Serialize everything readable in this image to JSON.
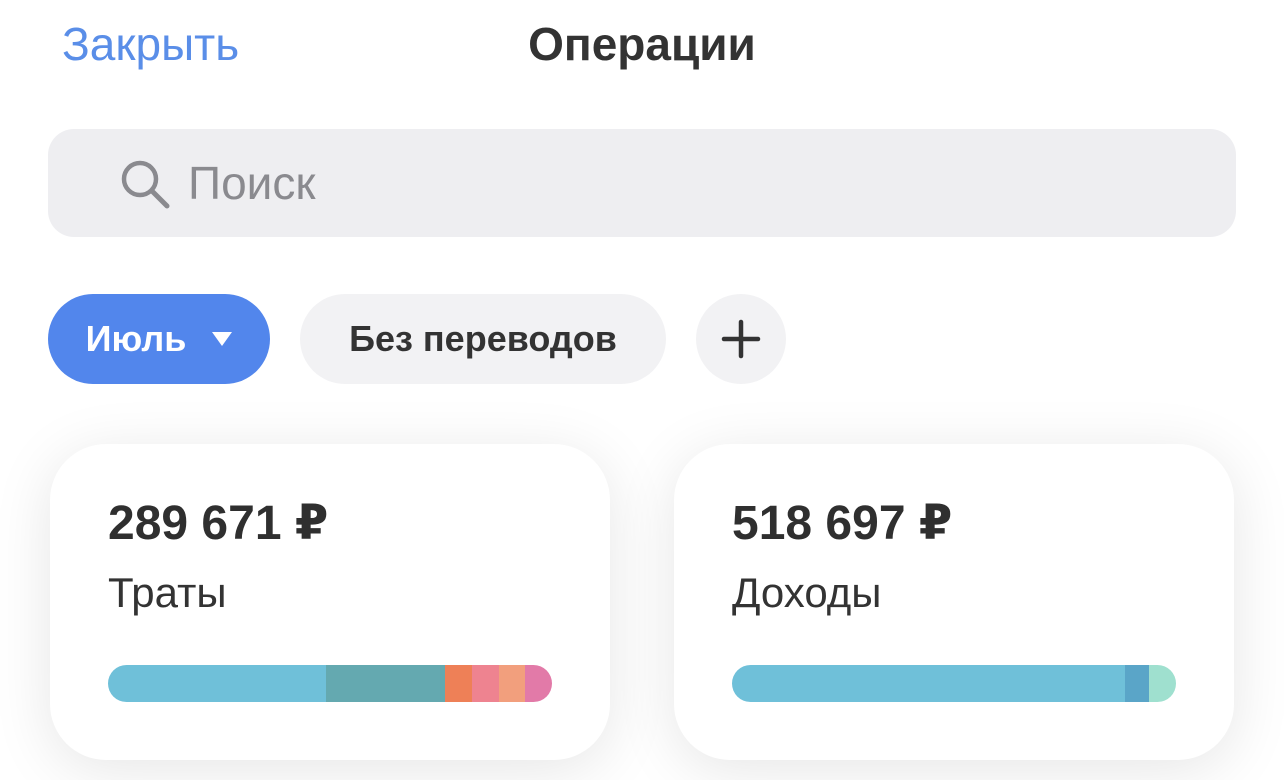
{
  "header": {
    "close_label": "Закрыть",
    "title": "Операции"
  },
  "search": {
    "placeholder": "Поиск",
    "value": ""
  },
  "filters": {
    "month_label": "Июль",
    "transfers_label": "Без переводов",
    "add_label": "+"
  },
  "cards": {
    "spending": {
      "amount": "289 671 ₽",
      "label": "Траты",
      "segments": [
        {
          "color": "#6fc0d9",
          "fraction": 0.49
        },
        {
          "color": "#64a9b0",
          "fraction": 0.27
        },
        {
          "color": "#ee8057",
          "fraction": 0.06
        },
        {
          "color": "#ee8390",
          "fraction": 0.06
        },
        {
          "color": "#f29f7d",
          "fraction": 0.06
        },
        {
          "color": "#e27aa8",
          "fraction": 0.06
        }
      ]
    },
    "income": {
      "amount": "518 697 ₽",
      "label": "Доходы",
      "segments": [
        {
          "color": "#6fc0d9",
          "fraction": 0.885
        },
        {
          "color": "#5aa5c8",
          "fraction": 0.055
        },
        {
          "color": "#9fe0cf",
          "fraction": 0.06
        }
      ]
    }
  },
  "colors": {
    "accent": "#5286ec",
    "link": "#5a8ee8"
  }
}
